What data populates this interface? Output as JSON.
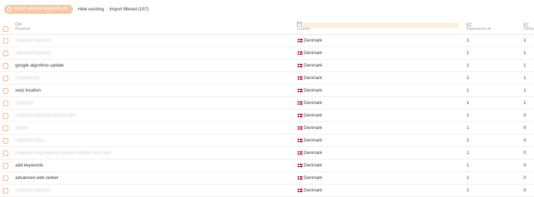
{
  "toolbar": {
    "import_selected": "Import selected keywords (0)",
    "hide_existing": "Hide existing",
    "import_filtered": "Import filtered (157)"
  },
  "columns": {
    "keyword": "Keyword",
    "country": "Country",
    "impressions": "Impressions",
    "clicks": "Clicks",
    "sort_indicator": "▼"
  },
  "rows": [
    {
      "keyword": "redacted keyword",
      "blurred": true,
      "country": "Denmark",
      "impressions": "1",
      "clicks": "1"
    },
    {
      "keyword": "redacted keyword",
      "blurred": true,
      "country": "Denmark",
      "impressions": "1",
      "clicks": "1"
    },
    {
      "keyword": "google algoritme update",
      "blurred": false,
      "country": "Denmark",
      "impressions": "1",
      "clicks": "1"
    },
    {
      "keyword": "redacted kw",
      "blurred": true,
      "country": "Denmark",
      "impressions": "1",
      "clicks": "1"
    },
    {
      "keyword": "serp location",
      "blurred": false,
      "country": "Denmark",
      "impressions": "1",
      "clicks": "1"
    },
    {
      "keyword": "redacted",
      "blurred": true,
      "country": "Denmark",
      "impressions": "1",
      "clicks": "1"
    },
    {
      "keyword": "redacted keyword phrase here",
      "blurred": true,
      "country": "Denmark",
      "impressions": "1",
      "clicks": "0"
    },
    {
      "keyword": "redact",
      "blurred": true,
      "country": "Denmark",
      "impressions": "1",
      "clicks": "0"
    },
    {
      "keyword": "redacted keyw",
      "blurred": true,
      "country": "Denmark",
      "impressions": "1",
      "clicks": "0"
    },
    {
      "keyword": "redacted long keyword phrase hidden from view",
      "blurred": true,
      "country": "Denmark",
      "impressions": "1",
      "clicks": "0"
    },
    {
      "keyword": "add keywords",
      "blurred": false,
      "country": "Denmark",
      "impressions": "1",
      "clicks": "0"
    },
    {
      "keyword": "advanced web ranker",
      "blurred": false,
      "country": "Denmark",
      "impressions": "1",
      "clicks": "0"
    },
    {
      "keyword": "redacted keyword",
      "blurred": true,
      "country": "Denmark",
      "impressions": "1",
      "clicks": "0"
    }
  ]
}
